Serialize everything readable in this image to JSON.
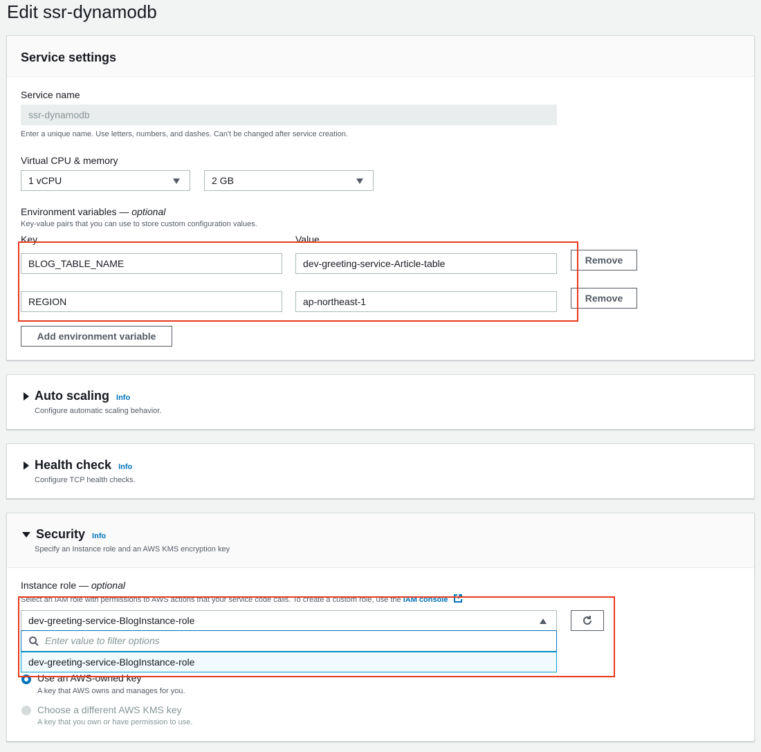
{
  "page": {
    "title": "Edit ssr-dynamodb"
  },
  "service_settings": {
    "heading": "Service settings",
    "service_name": {
      "label": "Service name",
      "value": "ssr-dynamodb",
      "description": "Enter a unique name. Use letters, numbers, and dashes. Can't be changed after service creation."
    },
    "cpu_memory": {
      "label": "Virtual CPU & memory",
      "cpu": "1 vCPU",
      "memory": "2 GB"
    },
    "env": {
      "label": "Environment variables",
      "label_suffix": "optional",
      "description": "Key-value pairs that you can use to store custom configuration values.",
      "key_header": "Key",
      "value_header": "Value",
      "rows": [
        {
          "key": "BLOG_TABLE_NAME",
          "value": "dev-greeting-service-Article-table",
          "remove": "Remove"
        },
        {
          "key": "REGION",
          "value": "ap-northeast-1",
          "remove": "Remove"
        }
      ],
      "add_button": "Add environment variable"
    }
  },
  "auto_scaling": {
    "heading": "Auto scaling",
    "info": "Info",
    "description": "Configure automatic scaling behavior."
  },
  "health_check": {
    "heading": "Health check",
    "info": "Info",
    "description": "Configure TCP health checks."
  },
  "security": {
    "heading": "Security",
    "info": "Info",
    "description": "Specify an Instance role and an AWS KMS encryption key",
    "instance_role": {
      "label": "Instance role",
      "label_suffix": "optional",
      "description_prefix": "Select an IAM role with permissions to AWS actions that your service code calls. To create a custom role, use the ",
      "description_link": "IAM console",
      "selected": "dev-greeting-service-BlogInstance-role",
      "filter_placeholder": "Enter value to filter options",
      "options": [
        "dev-greeting-service-BlogInstance-role"
      ]
    },
    "kms": {
      "option1_label": "Use an AWS-owned key",
      "option1_desc": "A key that AWS owns and manages for you.",
      "option2_label": "Choose a different AWS KMS key",
      "option2_desc": "A key that you own or have permission to use."
    }
  }
}
